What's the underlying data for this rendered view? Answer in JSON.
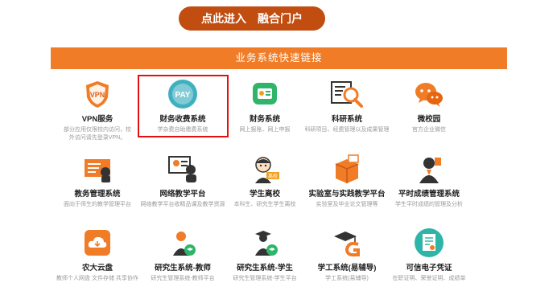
{
  "portal": {
    "label_a": "点此进入",
    "label_b": "融合门户"
  },
  "banner": {
    "title": "业务系统快速链接"
  },
  "tiles": [
    {
      "name": "VPN服务",
      "desc": "部分应用仅限校内访问，校外访问请先登录VPN。",
      "icon": "vpn-shield-icon"
    },
    {
      "name": "财务收费系统",
      "desc": "学杂费自助缴费系统",
      "icon": "pay-icon"
    },
    {
      "name": "财务系统",
      "desc": "网上报账、网上申报",
      "icon": "finance-icon"
    },
    {
      "name": "科研系统",
      "desc": "科研项目、经费管理以及成果管理",
      "icon": "research-magnifier-icon"
    },
    {
      "name": "微校园",
      "desc": "官方企业微信",
      "icon": "wechat-icon"
    },
    {
      "name": "教务管理系统",
      "desc": "面向于师生的教学管理平台",
      "icon": "teaching-admin-icon"
    },
    {
      "name": "网络教学平台",
      "desc": "网络教学平台收精品课及教学资源",
      "icon": "online-teaching-icon"
    },
    {
      "name": "学生离校",
      "desc": "本科生、研究生学生离校",
      "icon": "student-leave-icon"
    },
    {
      "name": "实验室与实践教学平台",
      "desc": "实验室及毕业论文管理等",
      "icon": "lab-box-icon"
    },
    {
      "name": "平时成绩管理系统",
      "desc": "学生平时成绩的管理及分析",
      "icon": "grades-icon"
    },
    {
      "name": "农大云盘",
      "desc": "教师个人网盘 文件存储 共享协作",
      "icon": "cloud-disk-icon"
    },
    {
      "name": "研究生系统-教师",
      "desc": "研究生管理系统-教师平台",
      "icon": "grad-teacher-icon"
    },
    {
      "name": "研究生系统-学生",
      "desc": "研究生管理系统-学生平台",
      "icon": "grad-student-icon"
    },
    {
      "name": "学工系统(易辅导)",
      "desc": "学工系统(易辅导)",
      "icon": "student-affairs-icon"
    },
    {
      "name": "可信电子凭证",
      "desc": "在职证明、荣誉证明、成绩单",
      "icon": "e-certificate-icon"
    }
  ],
  "pay_badge": "PAY",
  "leave_badge": "离校"
}
